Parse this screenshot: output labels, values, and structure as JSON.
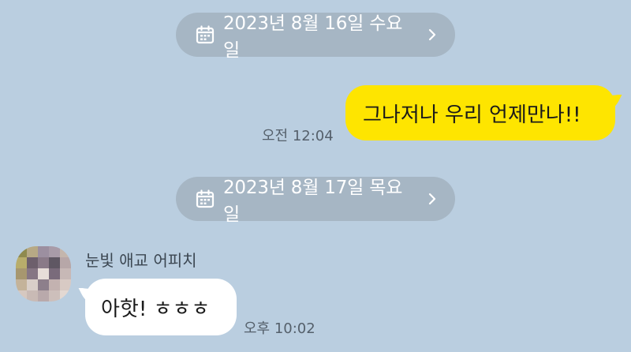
{
  "colors": {
    "background": "#bacee0",
    "date_pill_bg": "#a6b6c4",
    "outgoing_bubble": "#fee500",
    "incoming_bubble": "#ffffff"
  },
  "chat": {
    "date_dividers": [
      {
        "icon": "calendar-icon",
        "label": "2023년 8월 16일 수요일",
        "chevron": "chevron-right-icon"
      },
      {
        "icon": "calendar-icon",
        "label": "2023년 8월 17일 목요일",
        "chevron": "chevron-right-icon"
      }
    ],
    "messages": [
      {
        "direction": "outgoing",
        "text": "그나저나 우리 언제만나!!",
        "time": "오전 12:04"
      },
      {
        "direction": "incoming",
        "sender": "눈빛 애교 어피치",
        "text": "아핫! ㅎㅎㅎ",
        "time": "오후 10:02"
      }
    ]
  }
}
